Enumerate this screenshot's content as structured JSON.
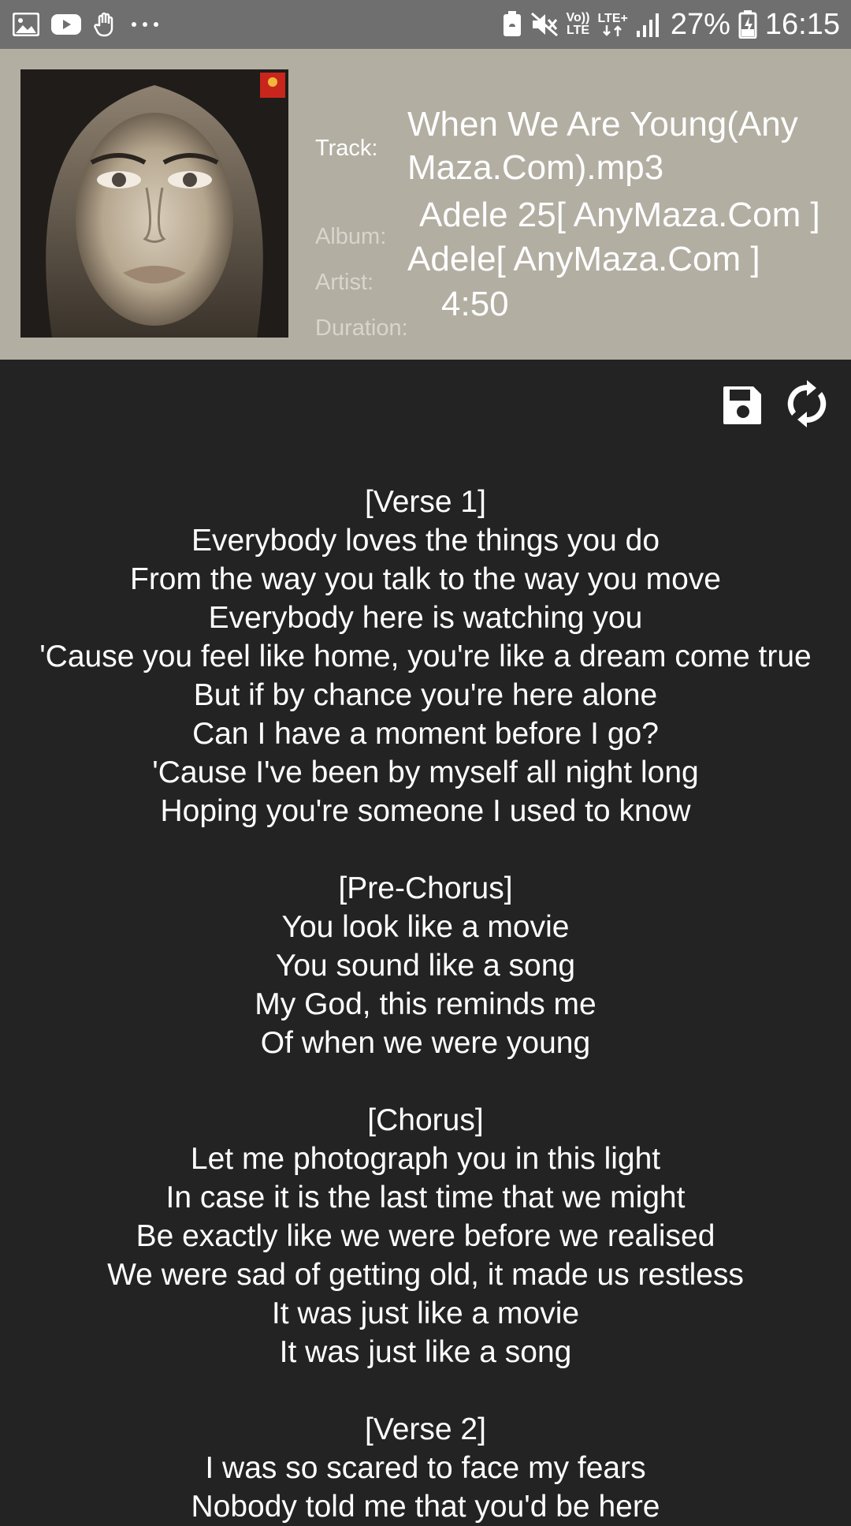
{
  "status_bar": {
    "battery": "27%",
    "time": "16:15",
    "volte_top": "Vo))",
    "volte_bottom": "LTE",
    "lte_label": "LTE+",
    "icons": [
      "gallery-icon",
      "youtube-icon",
      "hand-icon",
      "more-dots-icon",
      "battery-saver-icon",
      "mute-icon",
      "volte-icon",
      "lte-icon",
      "signal-icon",
      "battery-charging-icon"
    ]
  },
  "track": {
    "track_label": "Track:",
    "track_value": "When We Are Young(Any Maza.Com).mp3",
    "album_label": "Album:",
    "album_value": "Adele 25[ AnyMaza.Com ]",
    "artist_label": "Artist:",
    "artist_value": "Adele[ AnyMaza.Com ]",
    "duration_label": "Duration:",
    "duration_value": "4:50"
  },
  "toolbar": {
    "icons": [
      "save-icon",
      "refresh-icon"
    ]
  },
  "lyrics": "[Verse 1]\nEverybody loves the things you do\nFrom the way you talk to the way you move\nEverybody here is watching you\n'Cause you feel like home, you're like a dream come true\nBut if by chance you're here alone\nCan I have a moment before I go?\n'Cause I've been by myself all night long\nHoping you're someone I used to know\n\n[Pre-Chorus]\nYou look like a movie\nYou sound like a song\nMy God, this reminds me\nOf when we were young\n\n[Chorus]\nLet me photograph you in this light\nIn case it is the last time that we might\nBe exactly like we were before we realised\nWe were sad of getting old, it made us restless\nIt was just like a movie\nIt was just like a song\n\n[Verse 2]\nI was so scared to face my fears\nNobody told me that you'd be here",
  "colors": {
    "status_bar": "#6f6f6f",
    "header_bg": "#b2aea2",
    "content_bg": "#232323",
    "text": "#ffffff"
  }
}
